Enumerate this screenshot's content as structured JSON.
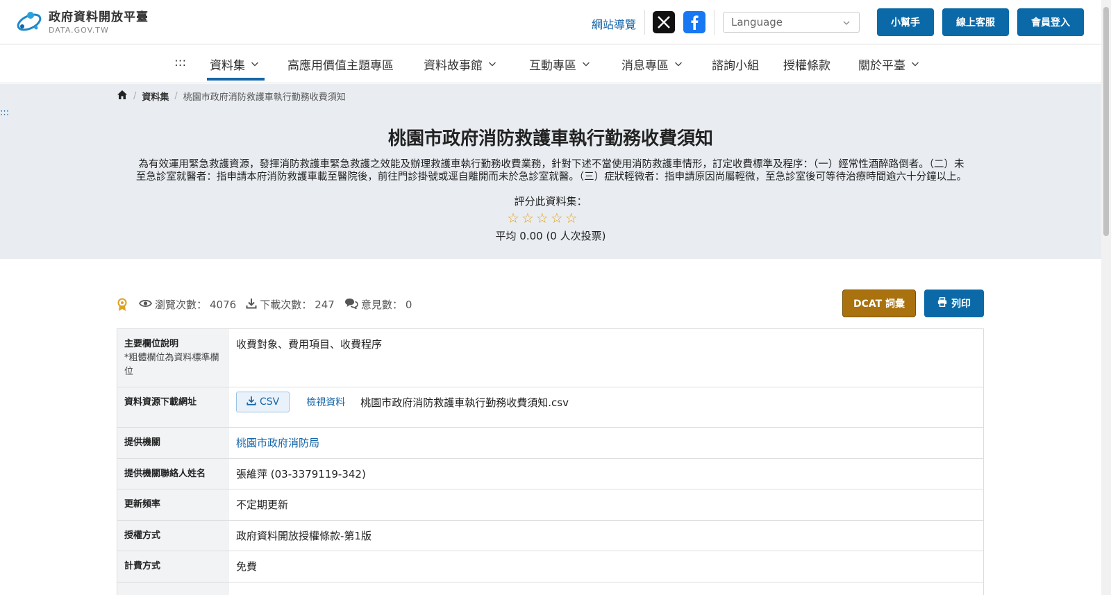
{
  "header": {
    "logo_title": "政府資料開放平臺",
    "logo_subtitle": "DATA.GOV.TW",
    "sitemap": "網站導覽",
    "language_placeholder": "Language",
    "buttons": {
      "helper": "小幫手",
      "online_service": "線上客服",
      "member_login": "會員登入"
    },
    "brand_color": "#0b69a8"
  },
  "nav": {
    "menu_glyph": ":::",
    "items": [
      {
        "label": "資料集",
        "dropdown": true,
        "active": true
      },
      {
        "label": "高應用價值主題專區",
        "dropdown": false
      },
      {
        "label": "資料故事館",
        "dropdown": true
      },
      {
        "label": "互動專區",
        "dropdown": true
      },
      {
        "label": "消息專區",
        "dropdown": true
      },
      {
        "label": "諮詢小組",
        "dropdown": false
      },
      {
        "label": "授權條款",
        "dropdown": false
      },
      {
        "label": "關於平臺",
        "dropdown": true
      }
    ]
  },
  "breadcrumb": {
    "section": "資料集",
    "current": "桃園市政府消防救護車執行勤務收費須知"
  },
  "hero": {
    "anchor": ":::",
    "title": "桃園市政府消防救護車執行勤務收費須知",
    "description_line1": "為有效運用緊急救護資源，發揮消防救護車緊急救護之效能及辦理救護車執行勤務收費業務，針對下述不當使用消防救護車情形，訂定收費標準及程序：（一）經常性酒醉路倒者。（二）未",
    "description_line2": "至急診室就醫者：指申請本府消防救護車載至醫院後，前往門診掛號或逕自離開而未於急診室就醫。（三）症狀輕微者：指申請原因尚屬輕微，至急診室後可等待治療時間逾六十分鐘以上。",
    "rating_label": "評分此資料集：",
    "rating_stars": 0,
    "rating_max": 5,
    "rating_summary": "平均 0.00 (0 人次投票)"
  },
  "stats": {
    "views_label": "瀏覽次數：",
    "views": "4076",
    "downloads_label": "下載次數：",
    "downloads": "247",
    "comments_label": "意見數：",
    "comments": "0",
    "dcat_button": "DCAT 詞彙",
    "print_button": "列印"
  },
  "table": {
    "rows": [
      {
        "label": "主要欄位說明",
        "note": "*粗體欄位為資料標準欄位",
        "value": "收費對象、費用項目、收費程序"
      },
      {
        "label": "資料資源下載網址",
        "csv": "CSV",
        "view": "檢視資料",
        "file": "桃園市政府消防救護車執行勤務收費須知.csv"
      },
      {
        "label": "提供機關",
        "value": "桃園市政府消防局"
      },
      {
        "label": "提供機關聯絡人姓名",
        "value": "張維萍 (03-3379119-342)"
      },
      {
        "label": "更新頻率",
        "value": "不定期更新"
      },
      {
        "label": "授權方式",
        "value": "政府資料開放授權條款-第1版"
      },
      {
        "label": "計費方式",
        "value": "免費"
      }
    ]
  }
}
